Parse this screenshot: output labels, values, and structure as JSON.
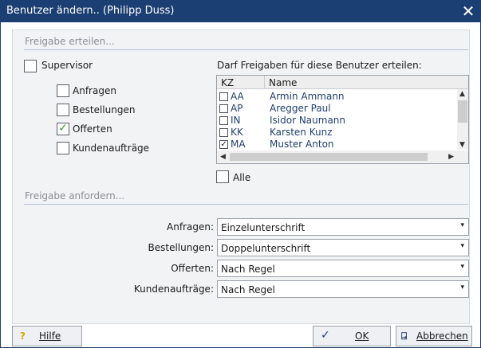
{
  "window": {
    "title": "Benutzer ändern.. (Philipp Duss)"
  },
  "sections": {
    "grant": "Freigabe erteilen...",
    "request": "Freigabe anfordern..."
  },
  "supervisor": {
    "label": "Supervisor",
    "checked": false
  },
  "permissions": [
    {
      "label": "Anfragen",
      "checked": false
    },
    {
      "label": "Bestellungen",
      "checked": false
    },
    {
      "label": "Offerten",
      "checked": true
    },
    {
      "label": "Kundenaufträge",
      "checked": false
    }
  ],
  "users_list": {
    "title": "Darf Freigaben für diese Benutzer erteilen:",
    "columns": [
      "KZ",
      "Name"
    ],
    "rows": [
      {
        "kz": "AA",
        "name": "Armin Ammann",
        "checked": false
      },
      {
        "kz": "AP",
        "name": "Aregger Paul",
        "checked": false
      },
      {
        "kz": "IN",
        "name": "Isidor Naumann",
        "checked": false
      },
      {
        "kz": "KK",
        "name": "Karsten Kunz",
        "checked": false
      },
      {
        "kz": "MA",
        "name": "Muster Anton",
        "checked": true
      }
    ]
  },
  "alle": {
    "label": "Alle",
    "checked": false
  },
  "requests": [
    {
      "label": "Anfragen:",
      "value": "Einzelunterschrift"
    },
    {
      "label": "Bestellungen:",
      "value": "Doppelunterschrift"
    },
    {
      "label": "Offerten:",
      "value": "Nach Regel"
    },
    {
      "label": "Kundenaufträge:",
      "value": "Nach Regel"
    }
  ],
  "buttons": {
    "help": "Hilfe",
    "ok": "OK",
    "cancel": "Abbrechen"
  },
  "icons": {
    "help": "question-mark-icon",
    "ok": "checkmark-icon",
    "cancel": "exit-door-icon",
    "close": "close-icon"
  },
  "colors": {
    "titlebar": "#1b3f72",
    "check": "#2a9d2a",
    "link_text": "#1f3e6e"
  }
}
